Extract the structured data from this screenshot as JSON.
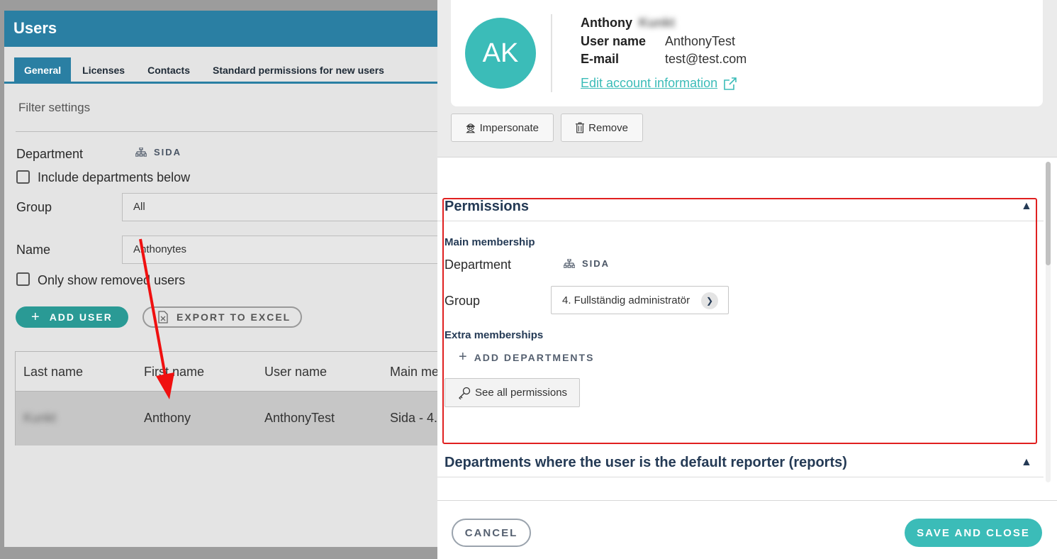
{
  "background_page": {
    "title": "Users",
    "tabs": [
      "General",
      "Licenses",
      "Contacts",
      "Standard permissions for new users"
    ],
    "filter_title": "Filter settings",
    "department_label": "Department",
    "department_value": "SIDA",
    "include_below_label": "Include departments below",
    "group_label": "Group",
    "group_value": "All",
    "name_label": "Name",
    "name_value": "Anthonytes",
    "only_removed_label": "Only show removed users",
    "add_user_label": "ADD USER",
    "export_label": "EXPORT TO EXCEL",
    "table": {
      "headers": [
        "Last name",
        "First name",
        "User name",
        "Main me"
      ],
      "row": [
        "Kunkt",
        "Anthony",
        "AnthonyTest",
        "Sida - 4."
      ]
    }
  },
  "panel": {
    "avatar_initials": "AK",
    "first_name": "Anthony",
    "last_name_blurred": "Kunkt",
    "username_label": "User name",
    "username_value": "AnthonyTest",
    "email_label": "E-mail",
    "email_value": "test@test.com",
    "edit_link": "Edit account information",
    "impersonate_label": "Impersonate",
    "remove_label": "Remove",
    "permissions": {
      "title": "Permissions",
      "main_membership": "Main membership",
      "department_label": "Department",
      "department_value": "SIDA",
      "group_label": "Group",
      "group_value": "4. Fullständig administratör",
      "extra_memberships": "Extra memberships",
      "add_departments": "ADD DEPARTMENTS",
      "see_all": "See all permissions"
    },
    "reporter_section_title": "Departments where the user is the default reporter (reports)",
    "cancel_label": "CANCEL",
    "save_label": "SAVE AND CLOSE"
  },
  "colors": {
    "header_blue": "#2a7fa3",
    "teal": "#3bbcb8",
    "highlight_red": "#e02020"
  }
}
